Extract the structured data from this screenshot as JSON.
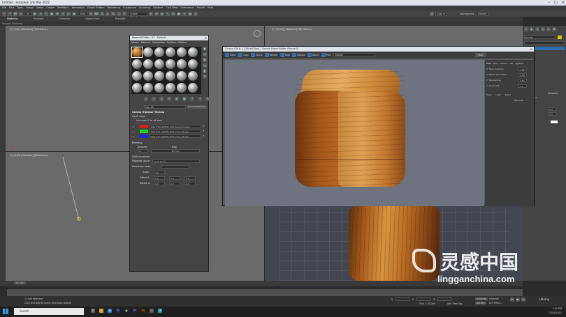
{
  "app": {
    "title": "Untitled - Autodesk 3ds Max 2022",
    "window_controls": [
      "–",
      "□",
      "✕"
    ]
  },
  "menu": [
    "File",
    "Edit",
    "Tools",
    "Group",
    "Views",
    "Create",
    "Modifiers",
    "Animation",
    "Graph Editors",
    "Rendering",
    "Customize",
    "Scripting",
    "Content",
    "Civil View",
    "Substance",
    "Arnold",
    "Help"
  ],
  "toolbar": {
    "all_dropdown": "All",
    "view_dropdown": "View",
    "selection_set": "Create Selection Set",
    "sign_in": "Sign In",
    "workspaces_label": "Workspaces:",
    "workspaces_value": "Default"
  },
  "ribbon": {
    "tabs": [
      "Modeling",
      "Freeform",
      "Selection",
      "Object Paint",
      "Populate"
    ],
    "sub": "Polygon Modeling"
  },
  "viewports": {
    "top_left": "[+] [Top] [Standard] [Wireframe]",
    "top_right": "[+] [Front] [Standard] [Wireframe]",
    "bottom_left": "[+] [Left] [Standard] [Wireframe]"
  },
  "material_editor": {
    "title": "Material Editor - 07 - Default",
    "menu": [
      "Modes",
      "Material",
      "Navigation",
      "Options",
      "Utilities"
    ],
    "map_dropdown": "Map #4",
    "map_type": "Corona Triplanar",
    "section_title": "Corona Triplanar Texmap",
    "input_maps": "Input maps",
    "use_map_x": "Use map X for all axes",
    "label_x": "X",
    "label_y": "Y",
    "label_z": "Z",
    "map_slots": [
      "Map #10 (WOOD_004_basecolor.jpg)",
      "Map #11 (WOOD_004_color_02.jpg)",
      "Map #12 (WOOD_004_color_03.jpg)"
    ],
    "blending": "Blending",
    "amount_label": "Amount:",
    "amount": "0.1",
    "map_label": "Map",
    "map_none": "No Map",
    "uvw_label": "UVW transform",
    "mapping_space_label": "Mapping space:",
    "mapping_space": "Local space",
    "reference_node": "Reference node:",
    "scale_label": "Scale:",
    "scale": "1.0",
    "offset_label": "Offset X:",
    "rotate_label": "Rotate X:",
    "zero": "0.0"
  },
  "render_window": {
    "title": "Corona Vfb 6 - [1280x800px] - Corona Frame Buffer (Frame 0)",
    "tools": [
      "Save",
      "Copy",
      "Clone",
      "Render",
      "Stop",
      "Region",
      "Zoom",
      "Pick"
    ],
    "dropdown": "Beauty",
    "stop_button": "Stop",
    "side_tabs": [
      "Post",
      "Stats",
      "History",
      "DR",
      "LightMix"
    ],
    "side_rows": [
      "Tone mapping",
      "Bloom and Glare",
      "Sharpening",
      "Denoising"
    ],
    "btn_save": "Save",
    "btn_load": "Load",
    "btn_reset": "Reset",
    "side_values": [
      "1.00",
      "0.50",
      "0.00",
      "1.0",
      "ASC CDL"
    ]
  },
  "command_panel": {
    "object_name": "Box001",
    "rows": [
      "Box",
      "Targeted",
      "Parameters",
      "Intensity",
      "Size",
      "Color",
      "Direction",
      "Visibility",
      "Occluded",
      "Shadows"
    ],
    "values": [
      "0.0",
      "0.5",
      "1.0"
    ]
  },
  "timeline": {
    "frame": "0 / 100",
    "status1": "1 Light Selected",
    "status2": "Click and drag to select and move objects",
    "auto_key": "Auto Key",
    "set_key": "Set Key",
    "selected": "Selected",
    "coord_x": "X:",
    "coord_y": "Y:",
    "coord_z": "Z:",
    "grid": "Grid = 10.0cm",
    "add_time_tag": "Add Time Tag",
    "key_filters": "Key Filters..."
  },
  "taskbar": {
    "search": "Search",
    "time": "3:52 PM",
    "date": "17/01/2021"
  },
  "watermark": {
    "cn": "灵感中国",
    "en": "lingganchina.com",
    "udemy": "Udemy"
  }
}
